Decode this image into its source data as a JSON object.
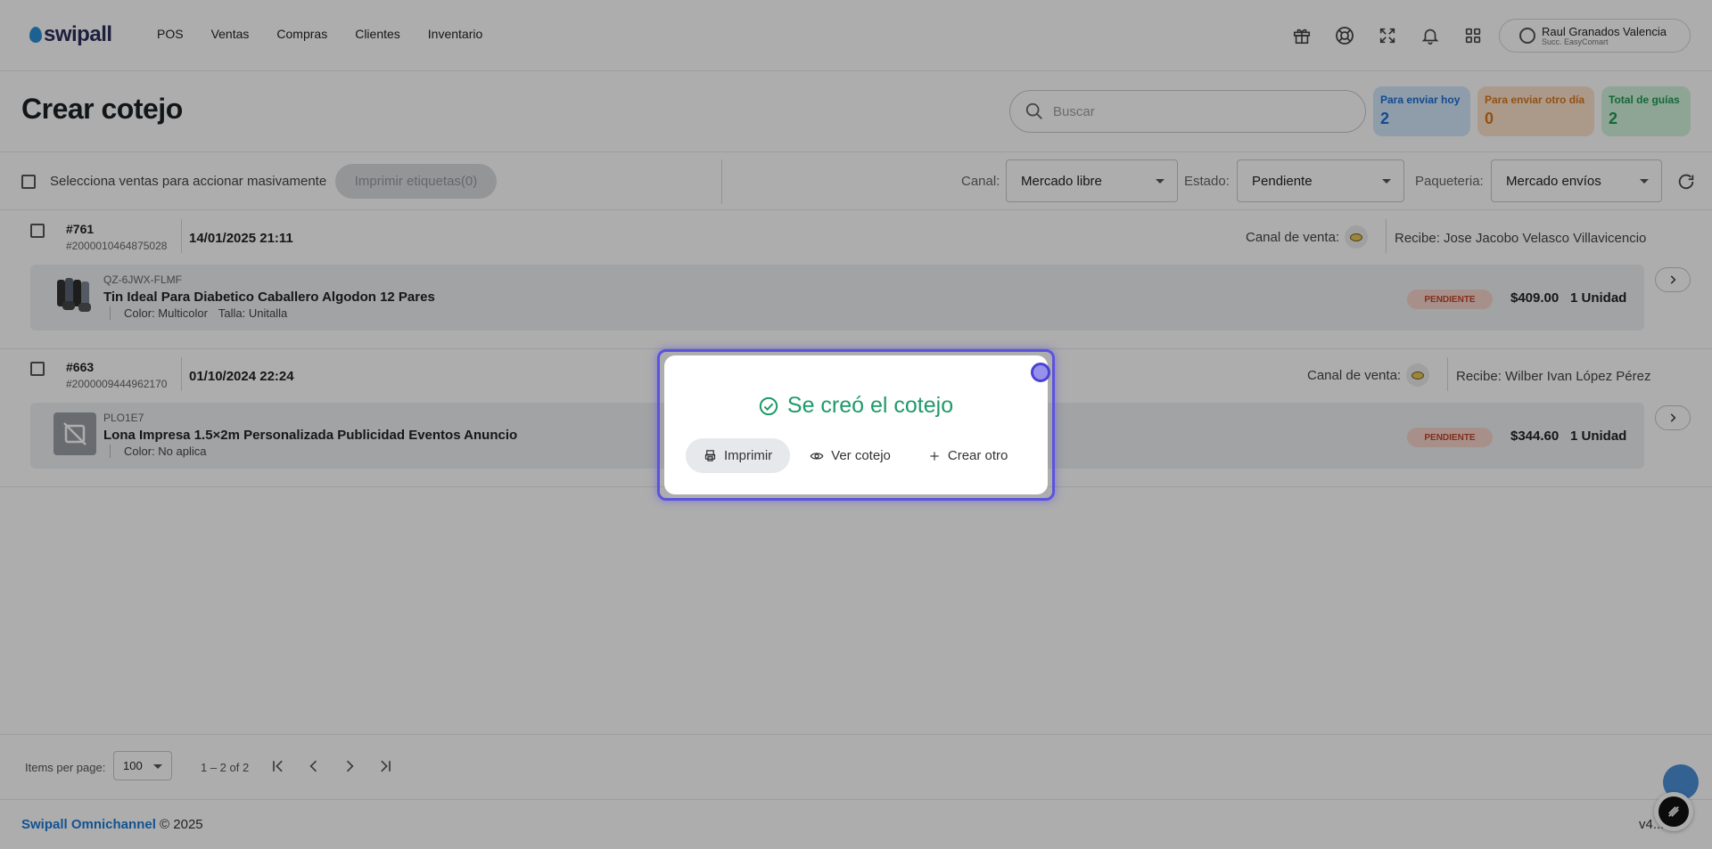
{
  "app": {
    "logo_text": "swipall",
    "nav": [
      "POS",
      "Ventas",
      "Compras",
      "Clientes",
      "Inventario"
    ],
    "user": {
      "name": "Raul Granados Valencia",
      "branch": "Succ. EasyComart"
    }
  },
  "header": {
    "title": "Crear cotejo",
    "search_placeholder": "Buscar",
    "stats": [
      {
        "label": "Para enviar hoy",
        "value": "2",
        "color": "#1a6fd1"
      },
      {
        "label": "Para enviar otro día",
        "value": "0",
        "color": "#d9771d"
      },
      {
        "label": "Total de guías",
        "value": "2",
        "color": "#1f9a52"
      }
    ]
  },
  "toolbar": {
    "select_all_label": "Selecciona ventas para accionar masivamente",
    "print_labels_button": "Imprimir etiquetas(0)",
    "canal_label": "Canal:",
    "canal_value": "Mercado libre",
    "estado_label": "Estado:",
    "estado_value": "Pendiente",
    "paqueteria_label": "Paqueteria:",
    "paqueteria_value": "Mercado envíos"
  },
  "orders": [
    {
      "number": "#761",
      "external_id": "#2000010464875028",
      "date": "14/01/2025 21:11",
      "canal_label": "Canal de venta:",
      "recibe": "Recibe: Jose Jacobo Velasco Villavicencio",
      "item": {
        "sku": "QZ-6JWX-FLMF",
        "title": "Tin Ideal Para Diabetico Caballero Algodon 12 Pares",
        "variants": [
          "Color: Multicolor",
          "Talla: Unitalla"
        ],
        "status": "PENDIENTE",
        "price": "$409.00",
        "qty": "1 Unidad"
      }
    },
    {
      "number": "#663",
      "external_id": "#2000009444962170",
      "date": "01/10/2024 22:24",
      "canal_label": "Canal de venta:",
      "recibe": "Recibe: Wilber Ivan López Pérez",
      "item": {
        "sku": "PLO1E7",
        "title": "Lona Impresa 1.5×2m Personalizada Publicidad Eventos Anuncio",
        "variants": [
          "Color: No aplica"
        ],
        "status": "PENDIENTE",
        "price": "$344.60",
        "qty": "1 Unidad"
      }
    }
  ],
  "pager": {
    "items_per_page_label": "Items per page:",
    "items_per_page": "100",
    "range": "1 – 2 of 2"
  },
  "footer": {
    "brand": "Swipall Omnichannel",
    "copyright": "© 2025",
    "version": "v4..."
  },
  "modal": {
    "message": "Se creó el cotejo",
    "print_button": "Imprimir",
    "view_button": "Ver cotejo",
    "create_button": "Crear otro",
    "accent": "#1f9a6a"
  }
}
